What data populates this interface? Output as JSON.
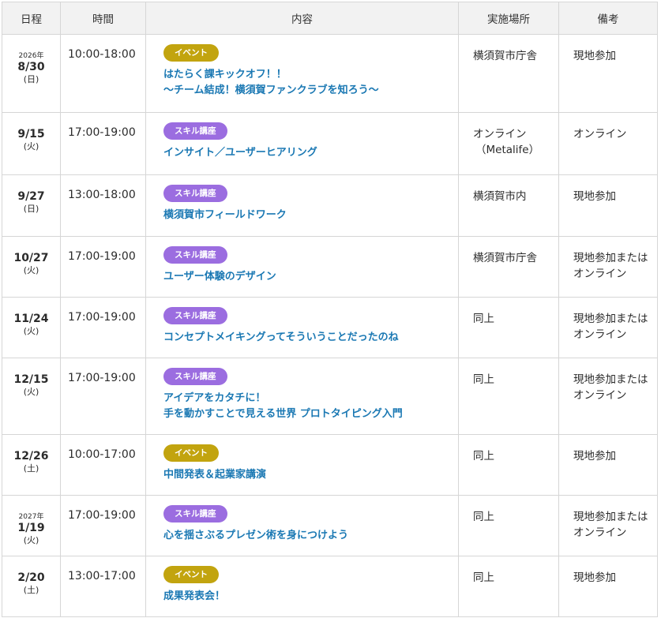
{
  "headers": [
    "日程",
    "時間",
    "内容",
    "実施場所",
    "備考"
  ],
  "rows": [
    {
      "year": "2026年",
      "date": "8/30",
      "dow": "(日)",
      "time": "10:00-18:00",
      "badge": "イベント",
      "badge_type": "event",
      "title1": "はたらく課キックオフ！！",
      "title2": "～チーム結成！横須賀ファンクラブを知ろう～",
      "place1": "横須賀市庁舎",
      "place2": "",
      "note1": "現地参加",
      "note2": ""
    },
    {
      "year": "",
      "date": "9/15",
      "dow": "(火)",
      "time": "17:00-19:00",
      "badge": "スキル講座",
      "badge_type": "skill",
      "title1": "インサイト／ユーザーヒアリング",
      "title2": "",
      "place1": "オンライン",
      "place2": "（Metalife）",
      "note1": "オンライン",
      "note2": ""
    },
    {
      "year": "",
      "date": "9/27",
      "dow": "(日)",
      "time": "13:00-18:00",
      "badge": "スキル講座",
      "badge_type": "skill",
      "title1": "横須賀市フィールドワーク",
      "title2": "",
      "place1": "横須賀市内",
      "place2": "",
      "note1": "現地参加",
      "note2": ""
    },
    {
      "year": "",
      "date": "10/27",
      "dow": "(火)",
      "time": "17:00-19:00",
      "badge": "スキル講座",
      "badge_type": "skill",
      "title1": "ユーザー体験のデザイン",
      "title2": "",
      "place1": "横須賀市庁舎",
      "place2": "",
      "note1": "現地参加または",
      "note2": "オンライン"
    },
    {
      "year": "",
      "date": "11/24",
      "dow": "(火)",
      "time": "17:00-19:00",
      "badge": "スキル講座",
      "badge_type": "skill",
      "title1": "コンセプトメイキングってそういうことだったのね",
      "title2": "",
      "place1": "同上",
      "place2": "",
      "note1": "現地参加または",
      "note2": "オンライン"
    },
    {
      "year": "",
      "date": "12/15",
      "dow": "(火)",
      "time": "17:00-19:00",
      "badge": "スキル講座",
      "badge_type": "skill",
      "title1": "アイデアをカタチに！",
      "title2": "手を動かすことで見える世界 プロトタイピング入門",
      "place1": "同上",
      "place2": "",
      "note1": "現地参加または",
      "note2": "オンライン"
    },
    {
      "year": "",
      "date": "12/26",
      "dow": "(土)",
      "time": "10:00-17:00",
      "badge": "イベント",
      "badge_type": "event",
      "title1": "中間発表＆起業家講演",
      "title2": "",
      "place1": "同上",
      "place2": "",
      "note1": "現地参加",
      "note2": ""
    },
    {
      "year": "2027年",
      "date": "1/19",
      "dow": "(火)",
      "time": "17:00-19:00",
      "badge": "スキル講座",
      "badge_type": "skill",
      "title1": "心を揺さぶるプレゼン術を身につけよう",
      "title2": "",
      "place1": "同上",
      "place2": "",
      "note1": "現地参加または",
      "note2": "オンライン"
    },
    {
      "year": "",
      "date": "2/20",
      "dow": "(土)",
      "time": "13:00-17:00",
      "badge": "イベント",
      "badge_type": "event",
      "title1": "成果発表会！",
      "title2": "",
      "place1": "同上",
      "place2": "",
      "note1": "現地参加",
      "note2": ""
    }
  ]
}
